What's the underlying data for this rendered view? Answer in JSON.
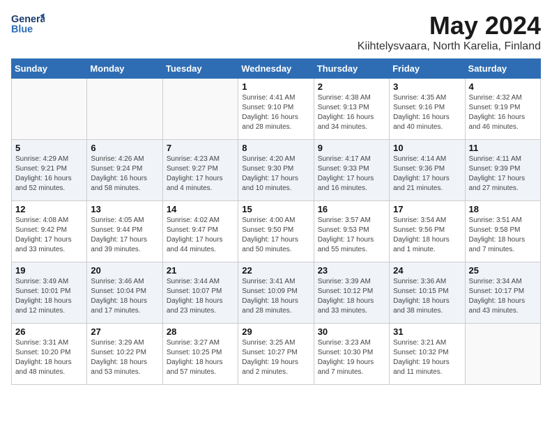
{
  "header": {
    "logo_line1": "General",
    "logo_line2": "Blue",
    "title": "May 2024",
    "subtitle": "Kiihtelysvaara, North Karelia, Finland"
  },
  "day_headers": [
    "Sunday",
    "Monday",
    "Tuesday",
    "Wednesday",
    "Thursday",
    "Friday",
    "Saturday"
  ],
  "weeks": [
    [
      {
        "date": "",
        "info": ""
      },
      {
        "date": "",
        "info": ""
      },
      {
        "date": "",
        "info": ""
      },
      {
        "date": "1",
        "info": "Sunrise: 4:41 AM\nSunset: 9:10 PM\nDaylight: 16 hours\nand 28 minutes."
      },
      {
        "date": "2",
        "info": "Sunrise: 4:38 AM\nSunset: 9:13 PM\nDaylight: 16 hours\nand 34 minutes."
      },
      {
        "date": "3",
        "info": "Sunrise: 4:35 AM\nSunset: 9:16 PM\nDaylight: 16 hours\nand 40 minutes."
      },
      {
        "date": "4",
        "info": "Sunrise: 4:32 AM\nSunset: 9:19 PM\nDaylight: 16 hours\nand 46 minutes."
      }
    ],
    [
      {
        "date": "5",
        "info": "Sunrise: 4:29 AM\nSunset: 9:21 PM\nDaylight: 16 hours\nand 52 minutes."
      },
      {
        "date": "6",
        "info": "Sunrise: 4:26 AM\nSunset: 9:24 PM\nDaylight: 16 hours\nand 58 minutes."
      },
      {
        "date": "7",
        "info": "Sunrise: 4:23 AM\nSunset: 9:27 PM\nDaylight: 17 hours\nand 4 minutes."
      },
      {
        "date": "8",
        "info": "Sunrise: 4:20 AM\nSunset: 9:30 PM\nDaylight: 17 hours\nand 10 minutes."
      },
      {
        "date": "9",
        "info": "Sunrise: 4:17 AM\nSunset: 9:33 PM\nDaylight: 17 hours\nand 16 minutes."
      },
      {
        "date": "10",
        "info": "Sunrise: 4:14 AM\nSunset: 9:36 PM\nDaylight: 17 hours\nand 21 minutes."
      },
      {
        "date": "11",
        "info": "Sunrise: 4:11 AM\nSunset: 9:39 PM\nDaylight: 17 hours\nand 27 minutes."
      }
    ],
    [
      {
        "date": "12",
        "info": "Sunrise: 4:08 AM\nSunset: 9:42 PM\nDaylight: 17 hours\nand 33 minutes."
      },
      {
        "date": "13",
        "info": "Sunrise: 4:05 AM\nSunset: 9:44 PM\nDaylight: 17 hours\nand 39 minutes."
      },
      {
        "date": "14",
        "info": "Sunrise: 4:02 AM\nSunset: 9:47 PM\nDaylight: 17 hours\nand 44 minutes."
      },
      {
        "date": "15",
        "info": "Sunrise: 4:00 AM\nSunset: 9:50 PM\nDaylight: 17 hours\nand 50 minutes."
      },
      {
        "date": "16",
        "info": "Sunrise: 3:57 AM\nSunset: 9:53 PM\nDaylight: 17 hours\nand 55 minutes."
      },
      {
        "date": "17",
        "info": "Sunrise: 3:54 AM\nSunset: 9:56 PM\nDaylight: 18 hours\nand 1 minute."
      },
      {
        "date": "18",
        "info": "Sunrise: 3:51 AM\nSunset: 9:58 PM\nDaylight: 18 hours\nand 7 minutes."
      }
    ],
    [
      {
        "date": "19",
        "info": "Sunrise: 3:49 AM\nSunset: 10:01 PM\nDaylight: 18 hours\nand 12 minutes."
      },
      {
        "date": "20",
        "info": "Sunrise: 3:46 AM\nSunset: 10:04 PM\nDaylight: 18 hours\nand 17 minutes."
      },
      {
        "date": "21",
        "info": "Sunrise: 3:44 AM\nSunset: 10:07 PM\nDaylight: 18 hours\nand 23 minutes."
      },
      {
        "date": "22",
        "info": "Sunrise: 3:41 AM\nSunset: 10:09 PM\nDaylight: 18 hours\nand 28 minutes."
      },
      {
        "date": "23",
        "info": "Sunrise: 3:39 AM\nSunset: 10:12 PM\nDaylight: 18 hours\nand 33 minutes."
      },
      {
        "date": "24",
        "info": "Sunrise: 3:36 AM\nSunset: 10:15 PM\nDaylight: 18 hours\nand 38 minutes."
      },
      {
        "date": "25",
        "info": "Sunrise: 3:34 AM\nSunset: 10:17 PM\nDaylight: 18 hours\nand 43 minutes."
      }
    ],
    [
      {
        "date": "26",
        "info": "Sunrise: 3:31 AM\nSunset: 10:20 PM\nDaylight: 18 hours\nand 48 minutes."
      },
      {
        "date": "27",
        "info": "Sunrise: 3:29 AM\nSunset: 10:22 PM\nDaylight: 18 hours\nand 53 minutes."
      },
      {
        "date": "28",
        "info": "Sunrise: 3:27 AM\nSunset: 10:25 PM\nDaylight: 18 hours\nand 57 minutes."
      },
      {
        "date": "29",
        "info": "Sunrise: 3:25 AM\nSunset: 10:27 PM\nDaylight: 19 hours\nand 2 minutes."
      },
      {
        "date": "30",
        "info": "Sunrise: 3:23 AM\nSunset: 10:30 PM\nDaylight: 19 hours\nand 7 minutes."
      },
      {
        "date": "31",
        "info": "Sunrise: 3:21 AM\nSunset: 10:32 PM\nDaylight: 19 hours\nand 11 minutes."
      },
      {
        "date": "",
        "info": ""
      }
    ]
  ]
}
